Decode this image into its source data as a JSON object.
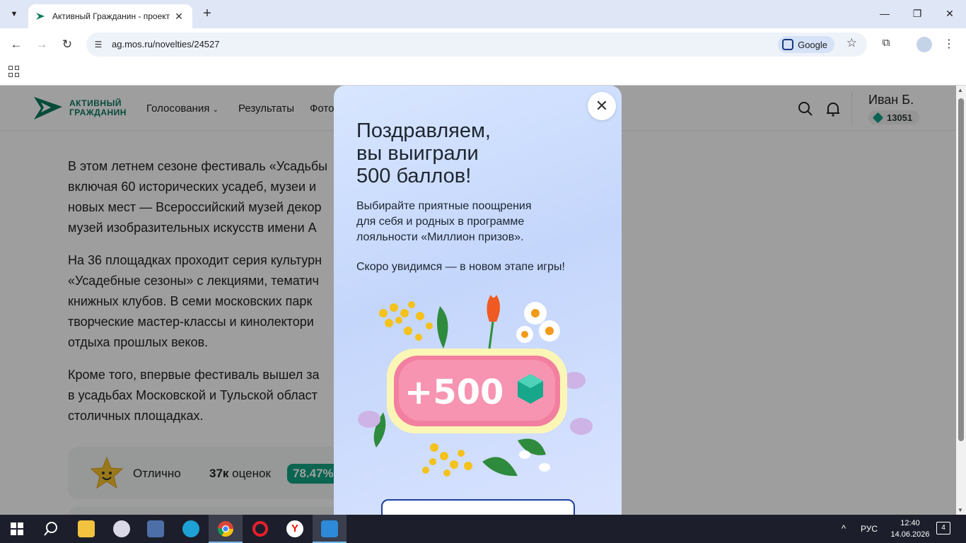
{
  "browser": {
    "tab_title": "Активный Гражданин - проект",
    "url": "ag.mos.ru/novelties/24527",
    "lens_label": "Google"
  },
  "site": {
    "logo_line1": "АКТИВНЫЙ",
    "logo_line2": "ГРАЖДАНИН",
    "nav": [
      "Голосования",
      "Результаты",
      "Фото"
    ],
    "user_name": "Иван Б.",
    "user_points": "13051"
  },
  "article": {
    "paragraphs": [
      [
        "В этом летнем сезоне фестиваль «Усадьбы",
        "включая 60 исторических усадеб, музеи и",
        "новых мест — Всероссийский музей декор",
        "музей изобразительных искусств имени А"
      ],
      [
        "На 36 площадках проходит серия культурн",
        "«Усадебные сезоны» с лекциями, тематич",
        "книжных клубов. В семи московских парк",
        "творческие мастер-классы и кинолектори",
        "отдыха прошлых веков."
      ],
      [
        "Кроме того, впервые фестиваль вышел за",
        "в усадьбах Московской и Тульской област",
        "столичных площадках."
      ]
    ]
  },
  "rating": {
    "label": "Отлично",
    "count_bold": "37к",
    "count_rest": " оценок",
    "percent": "78.47%"
  },
  "modal": {
    "title": "Поздравляем,\nвы выиграли\n500 баллов!",
    "description": "Выбирайте приятные поощрения\nдля себя и родных в программе\nлояльности «Миллион призов».",
    "next_text": "Скоро увидимся — в новом этапе игры!",
    "prize_text": "+500",
    "close_symbol": "✕"
  },
  "taskbar": {
    "lang": "РУС",
    "time": "12:40",
    "date": "14.06.2026",
    "notifications": "4"
  },
  "colors": {
    "brand_green": "#0c7a5e",
    "modal_bg": "#c4d6fb",
    "button_border": "#1d3f9e"
  }
}
